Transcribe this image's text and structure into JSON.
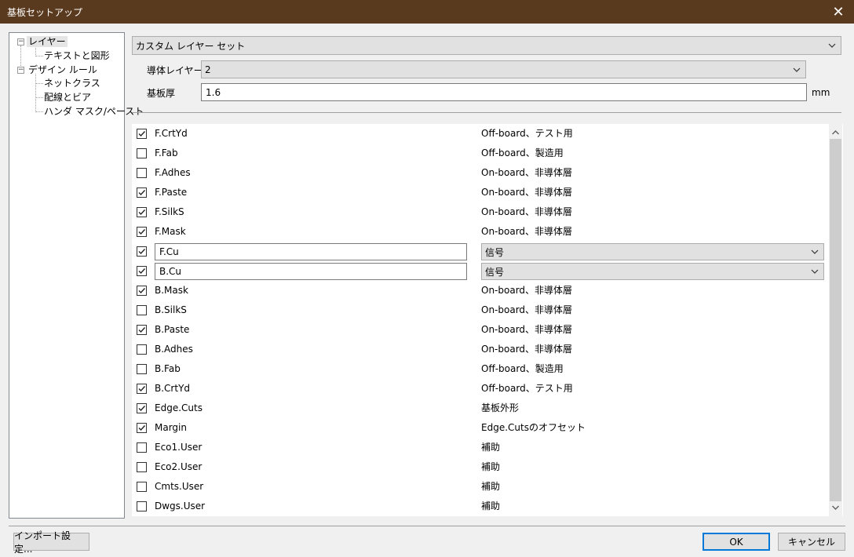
{
  "window": {
    "title": "基板セットアップ",
    "close_glyph": "✕"
  },
  "tree": {
    "items": [
      {
        "label": "レイヤー",
        "expander": "−"
      },
      {
        "label": "テキストと図形"
      },
      {
        "label": "デザイン ルール",
        "expander": "−"
      },
      {
        "label": "ネットクラス"
      },
      {
        "label": "配線とビア"
      },
      {
        "label": "ハンダ マスク/ペースト"
      }
    ]
  },
  "preset": {
    "value": "カスタム レイヤー セット"
  },
  "copper_layers": {
    "label": "導体レイヤー:",
    "value": "2"
  },
  "thickness": {
    "label": "基板厚",
    "value": "1.6",
    "unit": "mm"
  },
  "layers": [
    {
      "name": "F.CrtYd",
      "type": "Off-board、テスト用",
      "checked": true
    },
    {
      "name": "F.Fab",
      "type": "Off-board、製造用",
      "checked": false
    },
    {
      "name": "F.Adhes",
      "type": "On-board、非導体層",
      "checked": false
    },
    {
      "name": "F.Paste",
      "type": "On-board、非導体層",
      "checked": true
    },
    {
      "name": "F.SilkS",
      "type": "On-board、非導体層",
      "checked": true
    },
    {
      "name": "F.Mask",
      "type": "On-board、非導体層",
      "checked": true
    },
    {
      "name": "F.Cu",
      "type": "信号",
      "checked": true,
      "editable": true
    },
    {
      "name": "B.Cu",
      "type": "信号",
      "checked": true,
      "editable": true
    },
    {
      "name": "B.Mask",
      "type": "On-board、非導体層",
      "checked": true
    },
    {
      "name": "B.SilkS",
      "type": "On-board、非導体層",
      "checked": false
    },
    {
      "name": "B.Paste",
      "type": "On-board、非導体層",
      "checked": true
    },
    {
      "name": "B.Adhes",
      "type": "On-board、非導体層",
      "checked": false
    },
    {
      "name": "B.Fab",
      "type": "Off-board、製造用",
      "checked": false
    },
    {
      "name": "B.CrtYd",
      "type": "Off-board、テスト用",
      "checked": true
    },
    {
      "name": "Edge.Cuts",
      "type": "基板外形",
      "checked": true
    },
    {
      "name": "Margin",
      "type": "Edge.Cutsのオフセット",
      "checked": true
    },
    {
      "name": "Eco1.User",
      "type": "補助",
      "checked": false
    },
    {
      "name": "Eco2.User",
      "type": "補助",
      "checked": false
    },
    {
      "name": "Cmts.User",
      "type": "補助",
      "checked": false
    },
    {
      "name": "Dwgs.User",
      "type": "補助",
      "checked": false
    }
  ],
  "buttons": {
    "import": "インポート設定...",
    "ok": "OK",
    "cancel": "キャンセル"
  },
  "colors": {
    "titlebar": "#5a3a1e",
    "default_button_border": "#0078d7"
  }
}
